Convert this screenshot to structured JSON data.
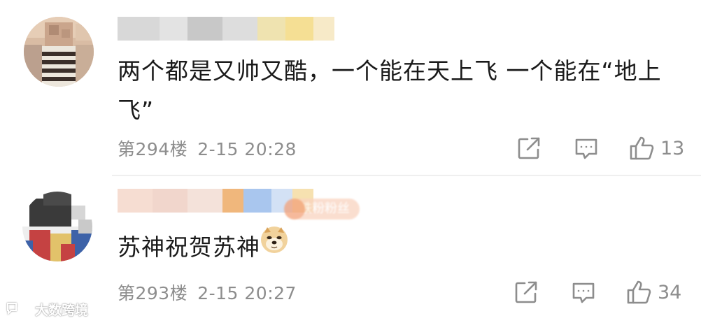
{
  "comments": [
    {
      "username": "Dear 狄",
      "text": "两个都是又帅又酷，一个能在天上飞 一个能在“地上飞”",
      "floor": "第294楼",
      "time": "2-15 20:28",
      "likes": "13",
      "avatar_colors": [
        "#d9bca4",
        "#caa58c",
        "#3b2f2a",
        "#ece6dc",
        "#bba08e"
      ]
    },
    {
      "username": "",
      "badge": "铁粉粉丝",
      "text": "苏神祝贺苏神",
      "emoji": "doge-emoji",
      "floor": "第293楼",
      "time": "2-15 20:27",
      "likes": "34",
      "avatar_colors": [
        "#3a3a3a",
        "#ffffff",
        "#c54242",
        "#3d62a8",
        "#e2c26a"
      ]
    }
  ],
  "icons": {
    "share": "share-icon",
    "reply": "reply-icon",
    "like": "thumbs-up-icon"
  },
  "watermark": {
    "text": "大数跨境",
    "icon": "speech-bubble-logo"
  },
  "colors": {
    "text": "#1a1a1a",
    "meta": "#8d8d8d",
    "divider": "#efefef",
    "background": "#ffffff"
  }
}
